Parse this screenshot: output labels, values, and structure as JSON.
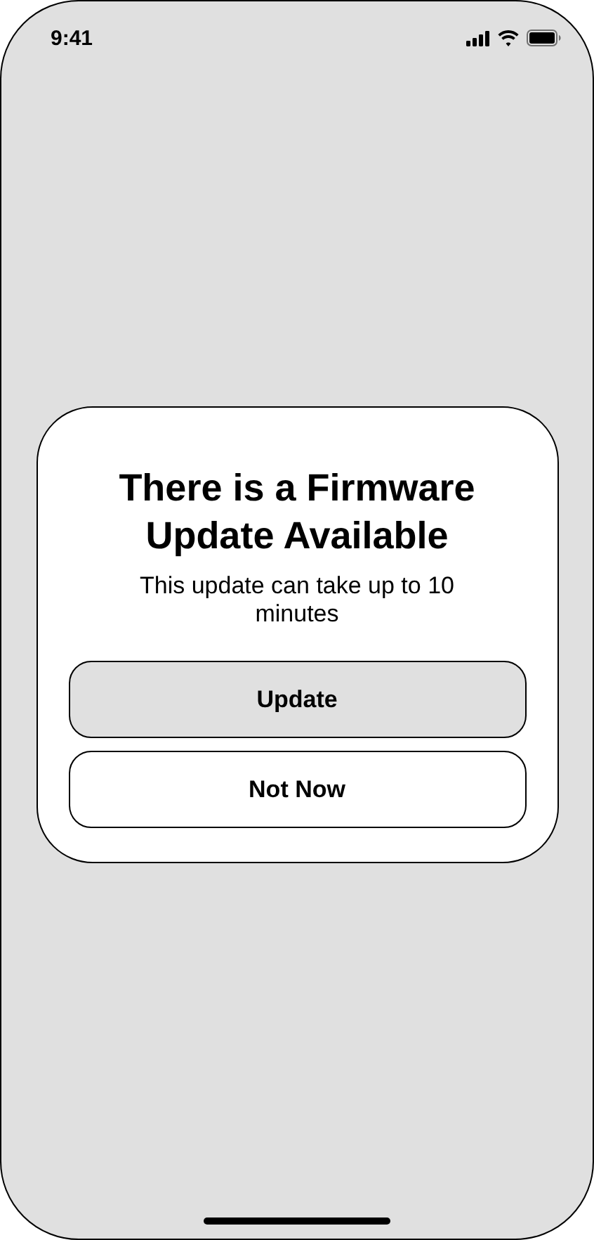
{
  "status_bar": {
    "time": "9:41"
  },
  "dialog": {
    "title": "There is a Firmware Update Available",
    "message": "This update can take up to 10 minutes",
    "buttons": [
      {
        "label": "Update",
        "kind": "filled"
      },
      {
        "label": "Not Now",
        "kind": "outlined"
      }
    ]
  }
}
